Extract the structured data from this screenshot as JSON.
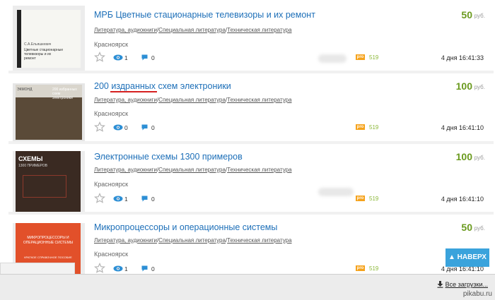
{
  "listings": [
    {
      "title": "МРБ Цветные стационарные телевизоры и их ремонт",
      "categories": [
        "Литература, аудиокниги",
        "Специальная литература",
        "Техническая литература"
      ],
      "city": "Красноярск",
      "views": "1",
      "comments": "0",
      "pro_label": "pro",
      "pro_count": "519",
      "date": "4 дня 16:41:33",
      "price": "50",
      "currency": "руб.",
      "thumb_text": "Цветные стационарные телевизоры и их ремонт",
      "thumb_author": "С.А.Ельяшкевич"
    },
    {
      "title": "200 издранных схем электроники",
      "categories": [
        "Литература, аудиокниги",
        "Специальная литература",
        "Техническая литература"
      ],
      "city": "Красноярск",
      "views": "0",
      "comments": "0",
      "pro_label": "pro",
      "pro_count": "519",
      "date": "4 дня 16:41:10",
      "price": "100",
      "currency": "руб.",
      "thumb_text": "200 избранных схем электроники",
      "thumb_author": "ЭКМОНД"
    },
    {
      "title": "Электронные схемы 1300 примеров",
      "categories": [
        "Литература, аудиокниги",
        "Специальная литература",
        "Техническая литература"
      ],
      "city": "Красноярск",
      "views": "1",
      "comments": "0",
      "pro_label": "pro",
      "pro_count": "519",
      "date": "4 дня 16:41:10",
      "price": "100",
      "currency": "руб.",
      "thumb_text": "СХЕМЫ",
      "thumb_author": "1300 ПРИМЕРОВ"
    },
    {
      "title": "Микропроцессоры и операционные системы",
      "categories": [
        "Литература, аудиокниги",
        "Специальная литература",
        "Техническая литература"
      ],
      "city": "Красноярск",
      "views": "1",
      "comments": "0",
      "pro_label": "pro",
      "pro_count": "519",
      "date": "4 дня 16:41:10",
      "price": "50",
      "currency": "руб.",
      "thumb_text": "МИКРОПРОЦЕССОРЫ И ОПЕРАЦИОННЫЕ СИСТЕМЫ",
      "thumb_author": "КРАТКОЕ СПРАВОЧНОЕ ПОСОБИЕ"
    }
  ],
  "ui": {
    "up_button": "▲ НАВЕРХ",
    "downloads_link": "Все загрузки...",
    "watermark": "pikabu.ru"
  },
  "colors": {
    "link": "#1d6fb8",
    "price": "#6a9a1e",
    "pro_badge": "#f5a21b",
    "pro_count": "#8bb838",
    "up_button": "#3aa3dc",
    "annotation_underline": "#d62020"
  }
}
